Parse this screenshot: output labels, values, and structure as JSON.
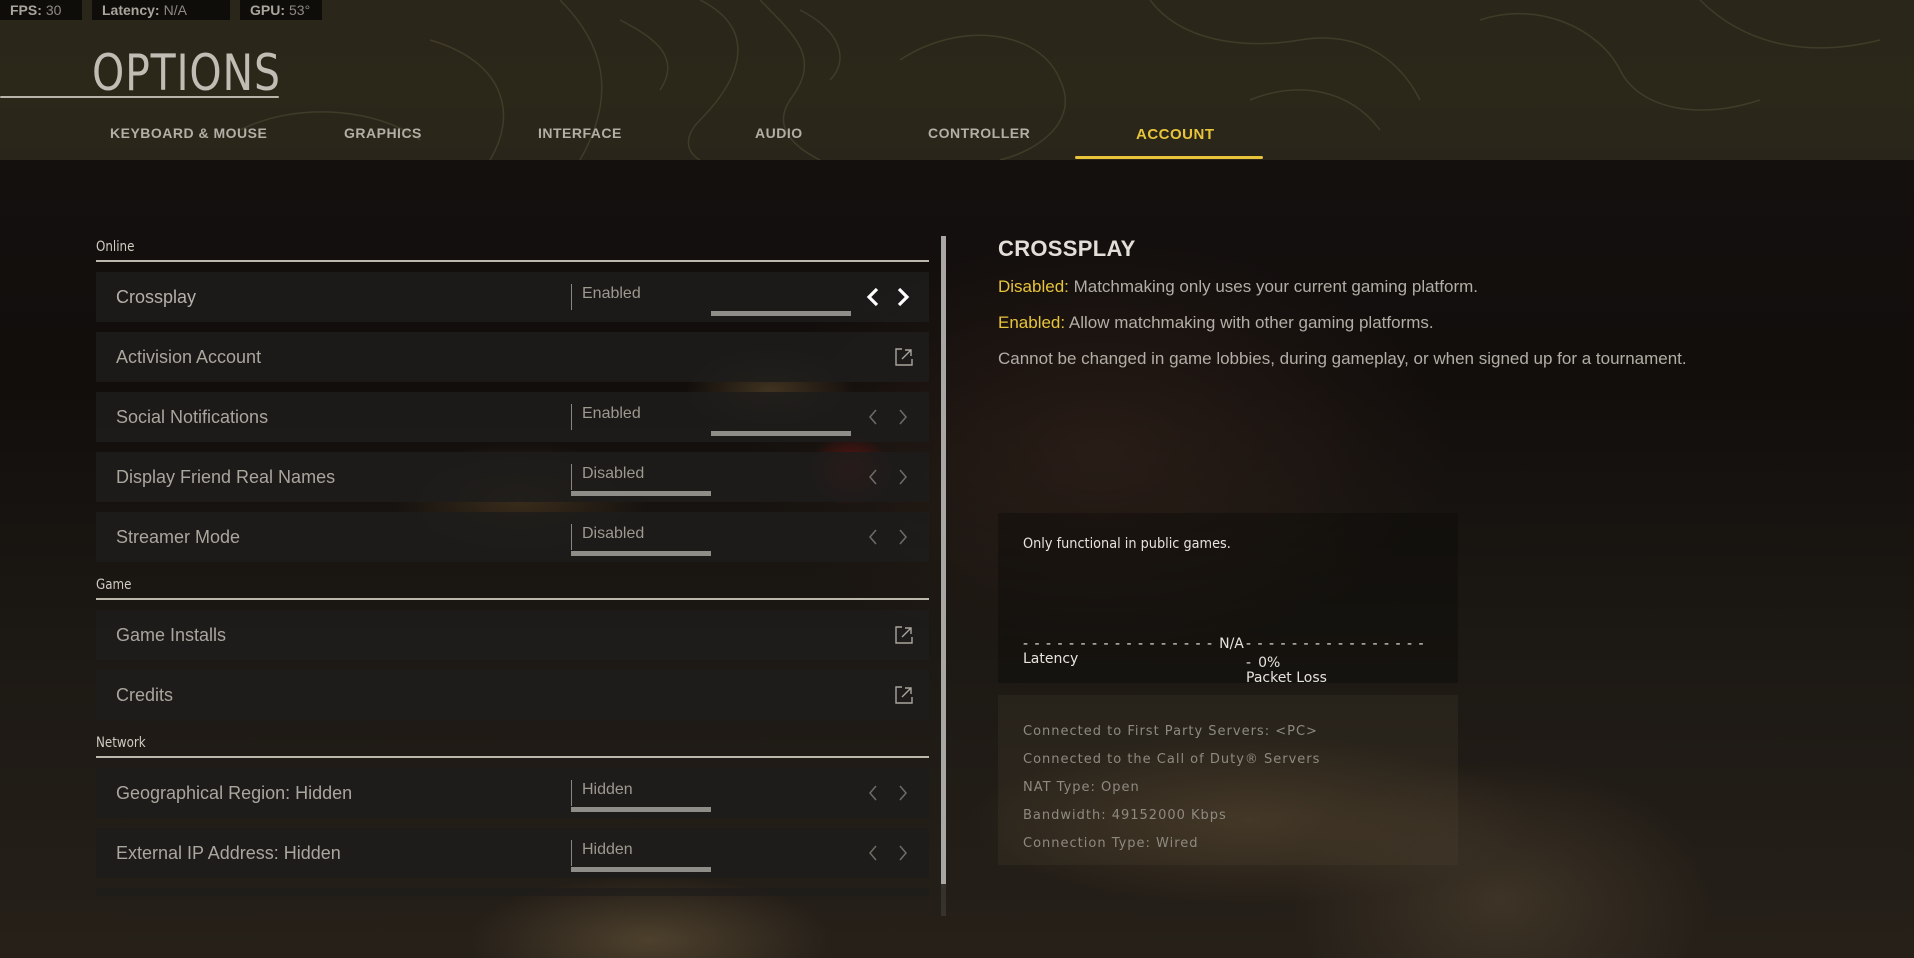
{
  "hud": {
    "fps_label": "FPS:",
    "fps_value": "30",
    "latency_label": "Latency:",
    "latency_value": "N/A",
    "gpu_label": "GPU:",
    "gpu_value": "53°"
  },
  "page_title": "OPTIONS",
  "tabs": [
    {
      "label": "KEYBOARD & MOUSE",
      "active": false
    },
    {
      "label": "GRAPHICS",
      "active": false
    },
    {
      "label": "INTERFACE",
      "active": false
    },
    {
      "label": "AUDIO",
      "active": false
    },
    {
      "label": "CONTROLLER",
      "active": false
    },
    {
      "label": "ACCOUNT",
      "active": true
    }
  ],
  "accent_color": "#e8c43a",
  "sections": {
    "online": {
      "label": "Online",
      "rows": [
        {
          "label": "Crossplay",
          "type": "toggle",
          "value": "Enabled",
          "selected_index": 1,
          "option_count": 2,
          "focused": true
        },
        {
          "label": "Activision Account",
          "type": "link",
          "icon": "external-link-icon"
        },
        {
          "label": "Social Notifications",
          "type": "toggle",
          "value": "Enabled",
          "selected_index": 1,
          "option_count": 2
        },
        {
          "label": "Display Friend Real Names",
          "type": "toggle",
          "value": "Disabled",
          "selected_index": 0,
          "option_count": 2
        },
        {
          "label": "Streamer Mode",
          "type": "toggle",
          "value": "Disabled",
          "selected_index": 0,
          "option_count": 2
        }
      ]
    },
    "game": {
      "label": "Game",
      "rows": [
        {
          "label": "Game Installs",
          "type": "link",
          "icon": "external-link-icon"
        },
        {
          "label": "Credits",
          "type": "link",
          "icon": "external-link-icon"
        }
      ]
    },
    "network": {
      "label": "Network",
      "rows": [
        {
          "label": "Geographical Region: Hidden",
          "type": "toggle",
          "value": "Hidden",
          "selected_index": 0,
          "option_count": 2
        },
        {
          "label": "External IP Address: Hidden",
          "type": "toggle",
          "value": "Hidden",
          "selected_index": 0,
          "option_count": 2
        }
      ]
    }
  },
  "description": {
    "title": "CROSSPLAY",
    "lines": [
      {
        "highlight": "Disabled:",
        "text": " Matchmaking only uses your current gaming platform."
      },
      {
        "highlight": "Enabled:",
        "text": " Allow matchmaking with other gaming platforms."
      },
      {
        "highlight": "",
        "text": "Cannot be changed in game lobbies, during gameplay, or when signed up for a tournament."
      }
    ]
  },
  "connection": {
    "note": "Only functional in public games.",
    "latency": {
      "label": "Latency",
      "value": "N/A",
      "dashes": "- - - - - - - - - - - - - - - - -"
    },
    "packet_loss": {
      "label": "Packet Loss",
      "value": "0%",
      "dashes": "- - - - - - - - - - - - - - - - -"
    },
    "info": [
      "Connected to First Party Servers: <PC>",
      "Connected to the Call of Duty® Servers",
      "NAT Type: Open",
      "Bandwidth: 49152000 Kbps",
      "Connection Type: Wired"
    ]
  }
}
